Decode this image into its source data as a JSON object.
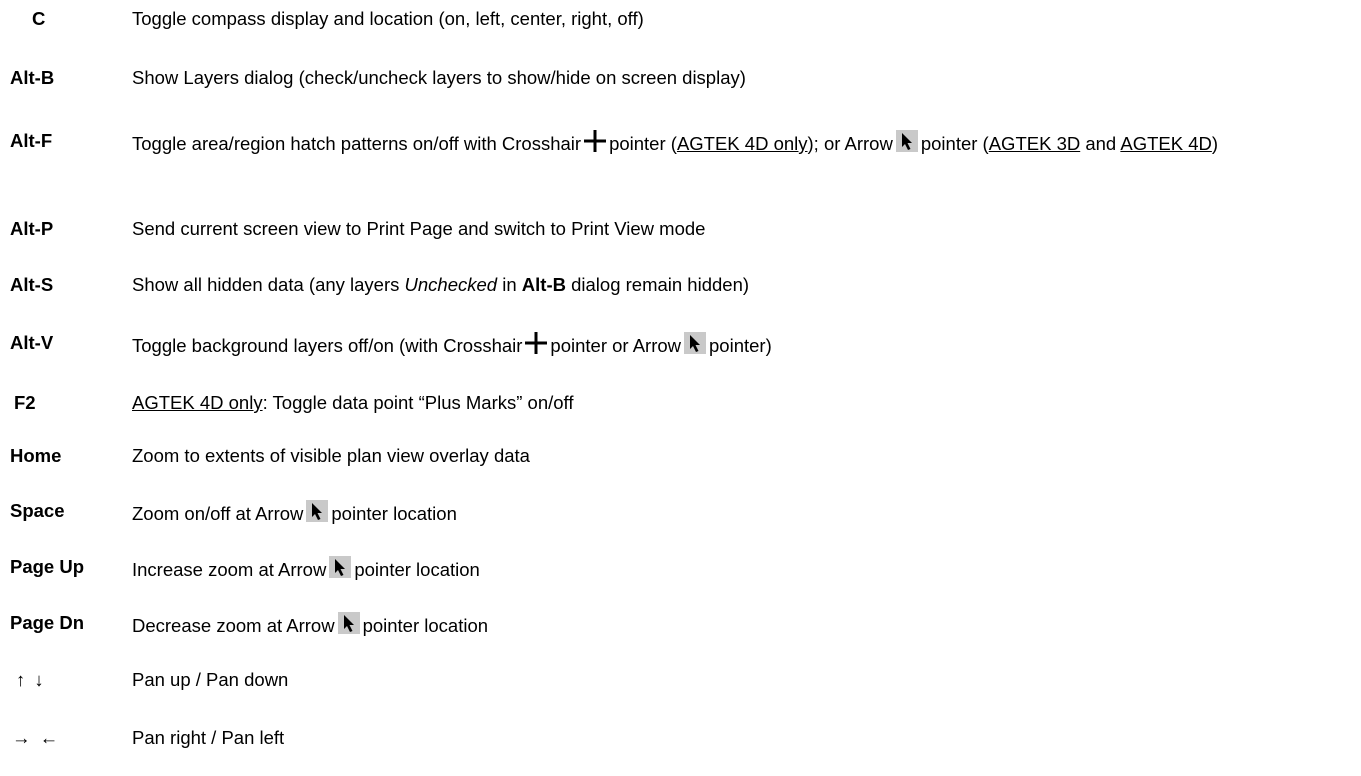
{
  "rows": [
    {
      "key": "C",
      "parts": [
        "Toggle compass display and location (on, left, center, right, off)"
      ]
    },
    {
      "key": "Alt-B",
      "parts": [
        "Show Layers dialog (check/uncheck layers to show/hide on screen display)"
      ]
    },
    {
      "key": "Alt-F",
      "parts": [
        "Toggle area/region hatch patterns on/off with Crosshair",
        "pointer (",
        "AGTEK 4D only",
        "); or Arrow",
        "pointer (",
        "AGTEK 3D",
        " and ",
        "AGTEK 4D",
        ")"
      ]
    },
    {
      "key": "Alt-P",
      "parts": [
        "Send current screen view to Print Page and switch to Print View mode"
      ]
    },
    {
      "key": "Alt-S",
      "parts": [
        "Show all hidden data (any layers ",
        "Unchecked",
        " in ",
        "Alt-B",
        " dialog remain hidden)"
      ]
    },
    {
      "key": "Alt-V",
      "parts": [
        "Toggle background layers off/on (with Crosshair",
        "pointer or Arrow",
        "pointer)"
      ]
    },
    {
      "key": "F2",
      "parts": [
        "AGTEK 4D only",
        ": Toggle data point “Plus Marks” on/off"
      ]
    },
    {
      "key": "Home",
      "parts": [
        "Zoom to extents of visible plan view overlay data"
      ]
    },
    {
      "key": "Space",
      "parts": [
        "Zoom on/off at Arrow",
        "pointer location"
      ]
    },
    {
      "key": "Page Up",
      "parts": [
        "Increase zoom at Arrow",
        "pointer location"
      ]
    },
    {
      "key": "Page Dn",
      "parts": [
        "Decrease zoom at Arrow",
        "pointer location"
      ]
    },
    {
      "key": "↑ ↓",
      "parts": [
        "Pan up / Pan down"
      ]
    },
    {
      "key": "→ ←",
      "parts": [
        "Pan right / Pan left"
      ]
    }
  ],
  "icons": {
    "crosshair": "crosshair-pointer-icon",
    "arrow": "arrow-pointer-icon"
  }
}
